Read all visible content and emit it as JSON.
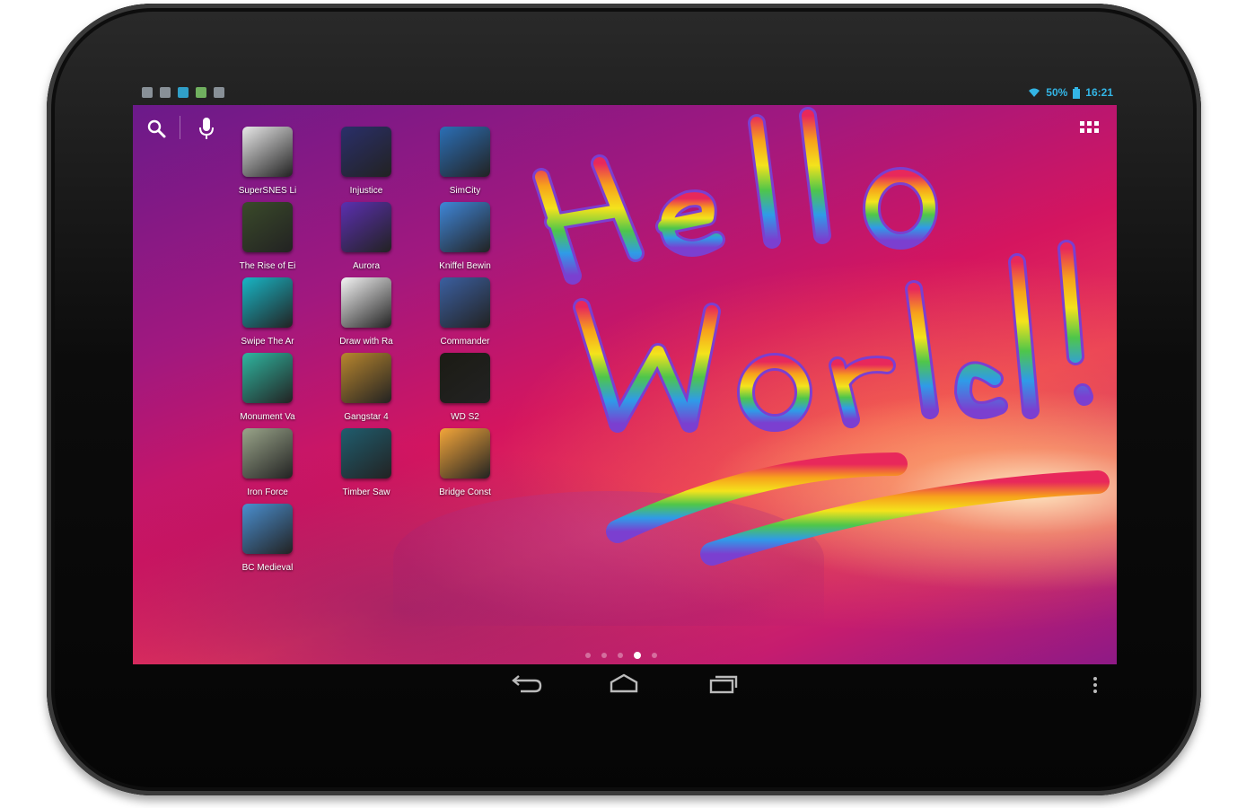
{
  "status_bar": {
    "battery": "50%",
    "time": "16:21",
    "accent_color": "#33b5e5"
  },
  "launcher": {
    "search_icon": "search-icon",
    "mic_icon": "microphone-icon",
    "apps_icon": "all-apps-grid-icon",
    "apps": [
      {
        "label": "SuperSNES Li",
        "icon": "supersnes-retro-icon",
        "color": "#e8e8e8"
      },
      {
        "label": "Injustice",
        "icon": "injustice-icon",
        "color": "#2a2f6a"
      },
      {
        "label": "SimCity",
        "icon": "simcity-icon",
        "color": "#2b6fb6"
      },
      {
        "label": "The Rise of Ei",
        "icon": "rise-of-empires-icon",
        "color": "#3a4a2a"
      },
      {
        "label": "Aurora",
        "icon": "aurora-icon",
        "color": "#5b2fb0"
      },
      {
        "label": "Kniffel Bewin",
        "icon": "kniffel-dice-icon",
        "color": "#3f86d8"
      },
      {
        "label": "Swipe The Ar",
        "icon": "swipe-arrow-icon",
        "color": "#18b6c6"
      },
      {
        "label": "Draw with Ra",
        "icon": "draw-rainbow-icon",
        "color": "#f4f4f4"
      },
      {
        "label": "Commander",
        "icon": "commander-icon",
        "color": "#3b5fa0"
      },
      {
        "label": "Monument Va",
        "icon": "monument-valley-icon",
        "color": "#2fb6a0"
      },
      {
        "label": "Gangstar 4",
        "icon": "gangstar-icon",
        "color": "#b8862e"
      },
      {
        "label": "WD S2",
        "icon": "walking-dead-icon",
        "color": "#1b1b14"
      },
      {
        "label": "Iron Force",
        "icon": "iron-force-tank-icon",
        "color": "#9aa58a"
      },
      {
        "label": "Timber Saw",
        "icon": "timber-saw-icon",
        "color": "#1f5d6e"
      },
      {
        "label": "Bridge Const",
        "icon": "bridge-constructor-icon",
        "color": "#f4a63a"
      },
      {
        "label": "BC Medieval",
        "icon": "bridge-constructor-medieval-icon",
        "color": "#4a8fd0"
      }
    ]
  },
  "drawing": {
    "text_line1": "Hello",
    "text_line2": "World!",
    "rainbow_colors": [
      "#e8285b",
      "#f7a21b",
      "#f4e31c",
      "#4fc64a",
      "#2f9be8",
      "#7b3fd0"
    ]
  },
  "pager": {
    "pages": 5,
    "current": 4
  },
  "nav": {
    "back_icon": "back-arrow-icon",
    "home_icon": "home-icon",
    "recents_icon": "recent-apps-icon",
    "menu_icon": "overflow-menu-icon"
  }
}
